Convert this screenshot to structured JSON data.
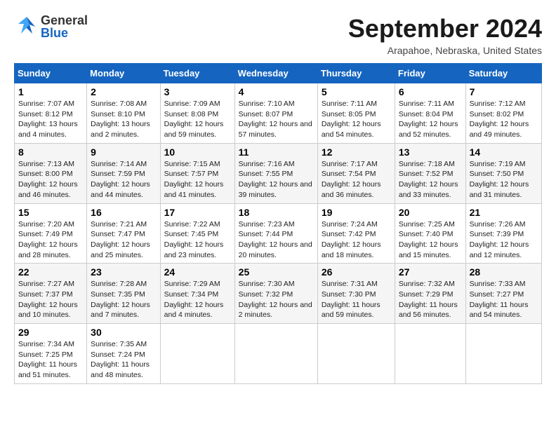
{
  "header": {
    "logo_general": "General",
    "logo_blue": "Blue",
    "title": "September 2024",
    "subtitle": "Arapahoe, Nebraska, United States"
  },
  "days_of_week": [
    "Sunday",
    "Monday",
    "Tuesday",
    "Wednesday",
    "Thursday",
    "Friday",
    "Saturday"
  ],
  "weeks": [
    [
      {
        "day": "1",
        "sunrise": "7:07 AM",
        "sunset": "8:12 PM",
        "daylight": "13 hours and 4 minutes."
      },
      {
        "day": "2",
        "sunrise": "7:08 AM",
        "sunset": "8:10 PM",
        "daylight": "13 hours and 2 minutes."
      },
      {
        "day": "3",
        "sunrise": "7:09 AM",
        "sunset": "8:08 PM",
        "daylight": "12 hours and 59 minutes."
      },
      {
        "day": "4",
        "sunrise": "7:10 AM",
        "sunset": "8:07 PM",
        "daylight": "12 hours and 57 minutes."
      },
      {
        "day": "5",
        "sunrise": "7:11 AM",
        "sunset": "8:05 PM",
        "daylight": "12 hours and 54 minutes."
      },
      {
        "day": "6",
        "sunrise": "7:11 AM",
        "sunset": "8:04 PM",
        "daylight": "12 hours and 52 minutes."
      },
      {
        "day": "7",
        "sunrise": "7:12 AM",
        "sunset": "8:02 PM",
        "daylight": "12 hours and 49 minutes."
      }
    ],
    [
      {
        "day": "8",
        "sunrise": "7:13 AM",
        "sunset": "8:00 PM",
        "daylight": "12 hours and 46 minutes."
      },
      {
        "day": "9",
        "sunrise": "7:14 AM",
        "sunset": "7:59 PM",
        "daylight": "12 hours and 44 minutes."
      },
      {
        "day": "10",
        "sunrise": "7:15 AM",
        "sunset": "7:57 PM",
        "daylight": "12 hours and 41 minutes."
      },
      {
        "day": "11",
        "sunrise": "7:16 AM",
        "sunset": "7:55 PM",
        "daylight": "12 hours and 39 minutes."
      },
      {
        "day": "12",
        "sunrise": "7:17 AM",
        "sunset": "7:54 PM",
        "daylight": "12 hours and 36 minutes."
      },
      {
        "day": "13",
        "sunrise": "7:18 AM",
        "sunset": "7:52 PM",
        "daylight": "12 hours and 33 minutes."
      },
      {
        "day": "14",
        "sunrise": "7:19 AM",
        "sunset": "7:50 PM",
        "daylight": "12 hours and 31 minutes."
      }
    ],
    [
      {
        "day": "15",
        "sunrise": "7:20 AM",
        "sunset": "7:49 PM",
        "daylight": "12 hours and 28 minutes."
      },
      {
        "day": "16",
        "sunrise": "7:21 AM",
        "sunset": "7:47 PM",
        "daylight": "12 hours and 25 minutes."
      },
      {
        "day": "17",
        "sunrise": "7:22 AM",
        "sunset": "7:45 PM",
        "daylight": "12 hours and 23 minutes."
      },
      {
        "day": "18",
        "sunrise": "7:23 AM",
        "sunset": "7:44 PM",
        "daylight": "12 hours and 20 minutes."
      },
      {
        "day": "19",
        "sunrise": "7:24 AM",
        "sunset": "7:42 PM",
        "daylight": "12 hours and 18 minutes."
      },
      {
        "day": "20",
        "sunrise": "7:25 AM",
        "sunset": "7:40 PM",
        "daylight": "12 hours and 15 minutes."
      },
      {
        "day": "21",
        "sunrise": "7:26 AM",
        "sunset": "7:39 PM",
        "daylight": "12 hours and 12 minutes."
      }
    ],
    [
      {
        "day": "22",
        "sunrise": "7:27 AM",
        "sunset": "7:37 PM",
        "daylight": "12 hours and 10 minutes."
      },
      {
        "day": "23",
        "sunrise": "7:28 AM",
        "sunset": "7:35 PM",
        "daylight": "12 hours and 7 minutes."
      },
      {
        "day": "24",
        "sunrise": "7:29 AM",
        "sunset": "7:34 PM",
        "daylight": "12 hours and 4 minutes."
      },
      {
        "day": "25",
        "sunrise": "7:30 AM",
        "sunset": "7:32 PM",
        "daylight": "12 hours and 2 minutes."
      },
      {
        "day": "26",
        "sunrise": "7:31 AM",
        "sunset": "7:30 PM",
        "daylight": "11 hours and 59 minutes."
      },
      {
        "day": "27",
        "sunrise": "7:32 AM",
        "sunset": "7:29 PM",
        "daylight": "11 hours and 56 minutes."
      },
      {
        "day": "28",
        "sunrise": "7:33 AM",
        "sunset": "7:27 PM",
        "daylight": "11 hours and 54 minutes."
      }
    ],
    [
      {
        "day": "29",
        "sunrise": "7:34 AM",
        "sunset": "7:25 PM",
        "daylight": "11 hours and 51 minutes."
      },
      {
        "day": "30",
        "sunrise": "7:35 AM",
        "sunset": "7:24 PM",
        "daylight": "11 hours and 48 minutes."
      },
      null,
      null,
      null,
      null,
      null
    ]
  ],
  "labels": {
    "sunrise_label": "Sunrise:",
    "sunset_label": "Sunset:",
    "daylight_label": "Daylight:"
  }
}
